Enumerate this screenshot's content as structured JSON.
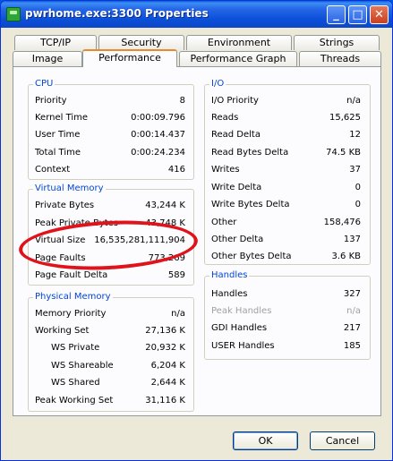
{
  "window": {
    "title": "pwrhome.exe:3300 Properties",
    "minimize": "_",
    "maximize": "□",
    "close": "✕"
  },
  "tabs_back": [
    "TCP/IP",
    "Security",
    "Environment",
    "Strings"
  ],
  "tabs_front": [
    "Image",
    "Performance",
    "Performance Graph",
    "Threads"
  ],
  "selected_tab": "Performance",
  "cpu": {
    "title": "CPU",
    "rows": [
      {
        "label": "Priority",
        "value": "8"
      },
      {
        "label": "Kernel Time",
        "value": "0:00:09.796"
      },
      {
        "label": "User Time",
        "value": "0:00:14.437"
      },
      {
        "label": "Total Time",
        "value": "0:00:24.234"
      },
      {
        "label": "Context",
        "value": "416"
      }
    ]
  },
  "virtual_memory": {
    "title": "Virtual Memory",
    "rows": [
      {
        "label": "Private Bytes",
        "value": "43,244 K"
      },
      {
        "label": "Peak Private Bytes",
        "value": "43,748 K"
      },
      {
        "label": "Virtual Size",
        "value": "16,535,281,111,904"
      },
      {
        "label": "Page Faults",
        "value": "773,269"
      },
      {
        "label": "Page Fault Delta",
        "value": "589"
      }
    ]
  },
  "physical_memory": {
    "title": "Physical Memory",
    "rows": [
      {
        "label": "Memory Priority",
        "value": "n/a"
      },
      {
        "label": "Working Set",
        "value": "27,136 K"
      },
      {
        "label": "WS Private",
        "value": "20,932 K"
      },
      {
        "label": "WS Shareable",
        "value": "6,204 K"
      },
      {
        "label": "WS Shared",
        "value": "2,644 K"
      },
      {
        "label": "Peak Working Set",
        "value": "31,116 K"
      }
    ]
  },
  "io": {
    "title": "I/O",
    "rows": [
      {
        "label": "I/O Priority",
        "value": "n/a"
      },
      {
        "label": "Reads",
        "value": "15,625"
      },
      {
        "label": "Read Delta",
        "value": "12"
      },
      {
        "label": "Read Bytes Delta",
        "value": "74.5  KB"
      },
      {
        "label": "Writes",
        "value": "37"
      },
      {
        "label": "Write Delta",
        "value": "0"
      },
      {
        "label": "Write Bytes Delta",
        "value": "0"
      },
      {
        "label": "Other",
        "value": "158,476"
      },
      {
        "label": "Other Delta",
        "value": "137"
      },
      {
        "label": "Other Bytes Delta",
        "value": "3.6  KB"
      }
    ]
  },
  "handles": {
    "title": "Handles",
    "rows": [
      {
        "label": "Handles",
        "value": "327"
      },
      {
        "label": "Peak Handles",
        "value": "n/a"
      },
      {
        "label": "GDI Handles",
        "value": "217"
      },
      {
        "label": "USER Handles",
        "value": "185"
      }
    ]
  },
  "buttons": {
    "ok": "OK",
    "cancel": "Cancel"
  },
  "colors": {
    "titlebar": "#0a4fd8",
    "group_title": "#0046d5",
    "annotation": "#e0121a",
    "selected_tab_accent": "#e68b2c"
  }
}
